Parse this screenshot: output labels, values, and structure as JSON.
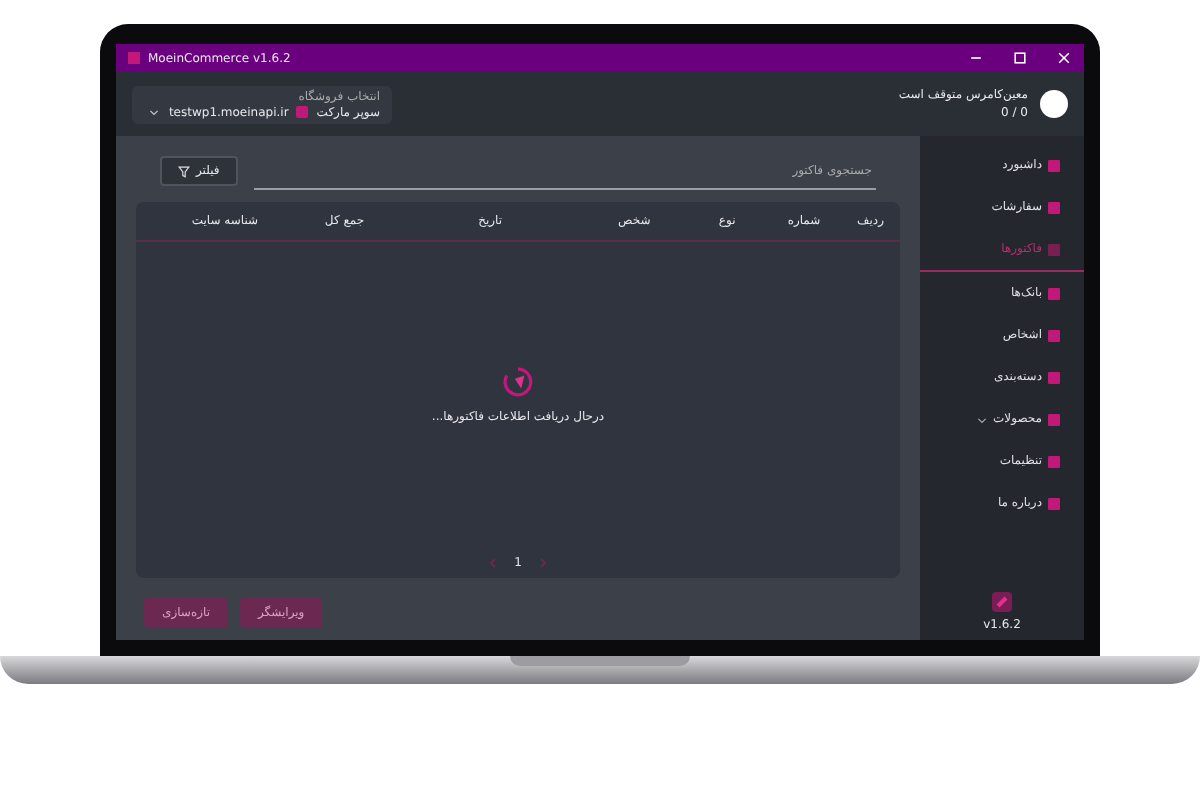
{
  "window": {
    "title": "MoeinCommerce v1.6.2"
  },
  "header": {
    "status": "معین‌کامرس متوقف است",
    "count": "0 / 0",
    "store_label": "انتخاب فروشگاه",
    "store_url": "testwp1.moeinapi.ir",
    "store_name": "سوپر مارکت"
  },
  "sidebar": {
    "items": [
      {
        "label": "داشبورد",
        "selected": false,
        "expandable": false
      },
      {
        "label": "سفارشات",
        "selected": false,
        "expandable": false
      },
      {
        "label": "فاکتورها",
        "selected": true,
        "expandable": false
      },
      {
        "label": "بانک‌ها",
        "selected": false,
        "expandable": false
      },
      {
        "label": "اشخاص",
        "selected": false,
        "expandable": false
      },
      {
        "label": "دسته‌بندی",
        "selected": false,
        "expandable": false
      },
      {
        "label": "محصولات",
        "selected": false,
        "expandable": true
      },
      {
        "label": "تنظیمات",
        "selected": false,
        "expandable": false
      },
      {
        "label": "درباره ما",
        "selected": false,
        "expandable": false
      }
    ],
    "version": "v1.6.2"
  },
  "search": {
    "placeholder": "جستجوی فاکتور"
  },
  "filter_button": "فیلتر",
  "table": {
    "columns": [
      "ردیف",
      "شماره",
      "نوع",
      "شخص",
      "تاریخ",
      "جمع کل",
      "شناسه سایت"
    ],
    "loading": "درحال دریافت اطلاعات فاکتورها..."
  },
  "pagination": {
    "page": "1"
  },
  "buttons": [
    "ویرایشگر",
    "تازه‌سازی"
  ]
}
